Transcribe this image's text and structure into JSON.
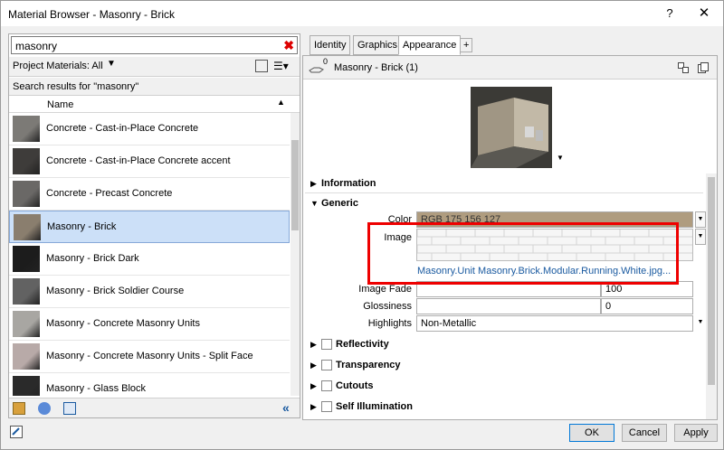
{
  "window": {
    "title": "Material Browser - Masonry - Brick",
    "help": "?",
    "close": "✕"
  },
  "search": {
    "value": "masonry",
    "clear": "✖"
  },
  "library": {
    "label": "Project Materials: All",
    "arrow": "▼"
  },
  "results_label": "Search results for \"masonry\"",
  "list_header": {
    "name": "Name",
    "sort": "▲"
  },
  "materials": [
    {
      "name": "Concrete - Cast-in-Place Concrete",
      "color": "#7c7a76"
    },
    {
      "name": "Concrete - Cast-in-Place Concrete accent",
      "color": "#3e3c3a"
    },
    {
      "name": "Concrete - Precast Concrete",
      "color": "#6a6866"
    },
    {
      "name": "Masonry - Brick",
      "color": "#8a7e6e",
      "selected": true
    },
    {
      "name": "Masonry - Brick Dark",
      "color": "#1c1c1c"
    },
    {
      "name": "Masonry - Brick Soldier Course",
      "color": "#626262"
    },
    {
      "name": "Masonry - Concrete Masonry Units",
      "color": "#a8a6a2"
    },
    {
      "name": "Masonry - Concrete Masonry Units - Split Face",
      "color": "#b8aaa8"
    },
    {
      "name": "Masonry - Glass Block",
      "color": "#2a2a2a"
    }
  ],
  "tabs": [
    {
      "label": "Identity"
    },
    {
      "label": "Graphics"
    },
    {
      "label": "Appearance",
      "active": true
    },
    {
      "label": "+"
    }
  ],
  "asset": {
    "count": "0",
    "name": "Masonry - Brick (1)"
  },
  "sections": {
    "information": "Information",
    "generic": "Generic",
    "reflectivity": "Reflectivity",
    "transparency": "Transparency",
    "cutouts": "Cutouts",
    "self_illumination": "Self Illumination"
  },
  "generic": {
    "color_label": "Color",
    "color_value": "RGB 175 156 127",
    "color_swatch": "#af9c7f",
    "image_label": "Image",
    "image_file": "Masonry.Unit Masonry.Brick.Modular.Running.White.jpg...",
    "image_fade_label": "Image Fade",
    "image_fade_value": "100",
    "glossiness_label": "Glossiness",
    "glossiness_value": "0",
    "highlights_label": "Highlights",
    "highlights_value": "Non-Metallic"
  },
  "buttons": {
    "ok": "OK",
    "cancel": "Cancel",
    "apply": "Apply"
  },
  "colors": {
    "highlight": "#e00000",
    "selection": "#cce0f8",
    "link": "#1a5aa0"
  }
}
